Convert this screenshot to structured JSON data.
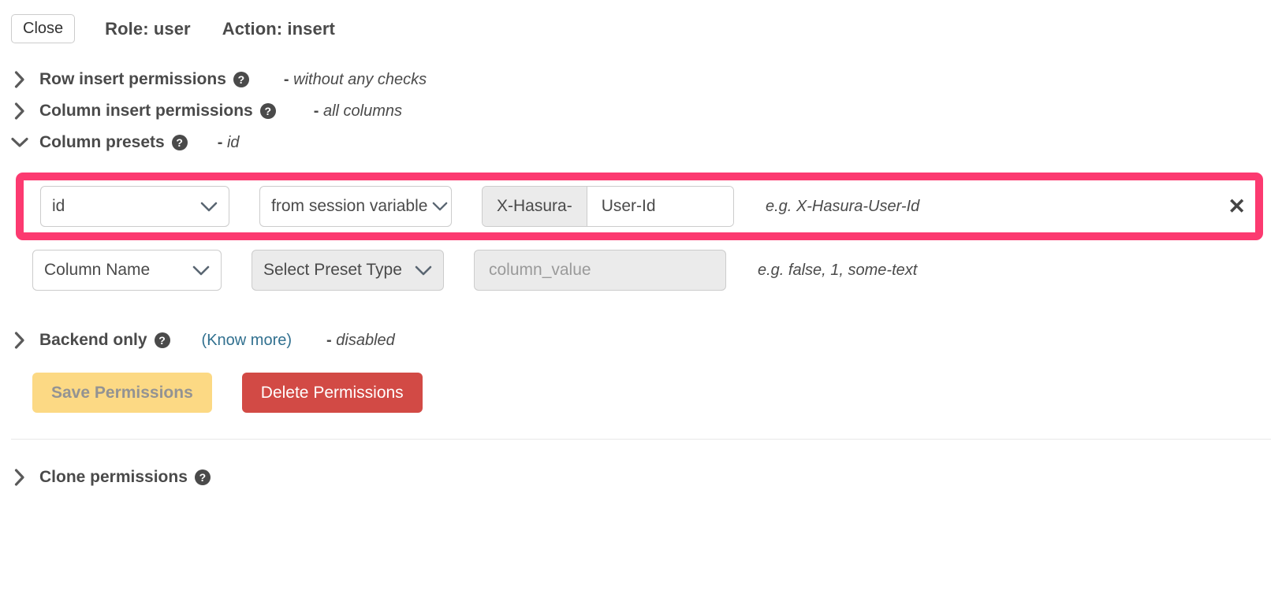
{
  "header": {
    "close_label": "Close",
    "role_label": "Role: user",
    "action_label": "Action: insert"
  },
  "sections": [
    {
      "title": "Row insert permissions",
      "expanded": false,
      "summary": "without any checks",
      "dash": "-"
    },
    {
      "title": "Column insert permissions",
      "expanded": false,
      "summary": "all columns",
      "dash": "-"
    },
    {
      "title": "Column presets",
      "expanded": true,
      "summary": "id",
      "dash": "-"
    }
  ],
  "backend_only": {
    "title": "Backend only",
    "know_more_label": "(Know more)",
    "dash": "-",
    "summary": "disabled"
  },
  "clone": {
    "title": "Clone permissions"
  },
  "presets": {
    "rows": [
      {
        "column": "id",
        "preset_type": "from session variable",
        "addon": "X-Hasura-",
        "value": "User-Id",
        "hint": "e.g. X-Hasura-User-Id",
        "remove_icon": "✕",
        "highlighted": true
      },
      {
        "column": "Column Name",
        "preset_type": "Select Preset Type",
        "value_placeholder": "column_value",
        "hint": "e.g. false, 1, some-text",
        "highlighted": false
      }
    ]
  },
  "buttons": {
    "save_label": "Save Permissions",
    "delete_label": "Delete Permissions"
  },
  "colors": {
    "highlight_pink": "#fc3a70",
    "save_bg": "#fcd984",
    "delete_bg": "#d24a45",
    "link_blue": "#31708f"
  },
  "icons": {
    "help": "?",
    "chevron_right": "chevron-right-icon",
    "chevron_down": "chevron-down-icon"
  }
}
